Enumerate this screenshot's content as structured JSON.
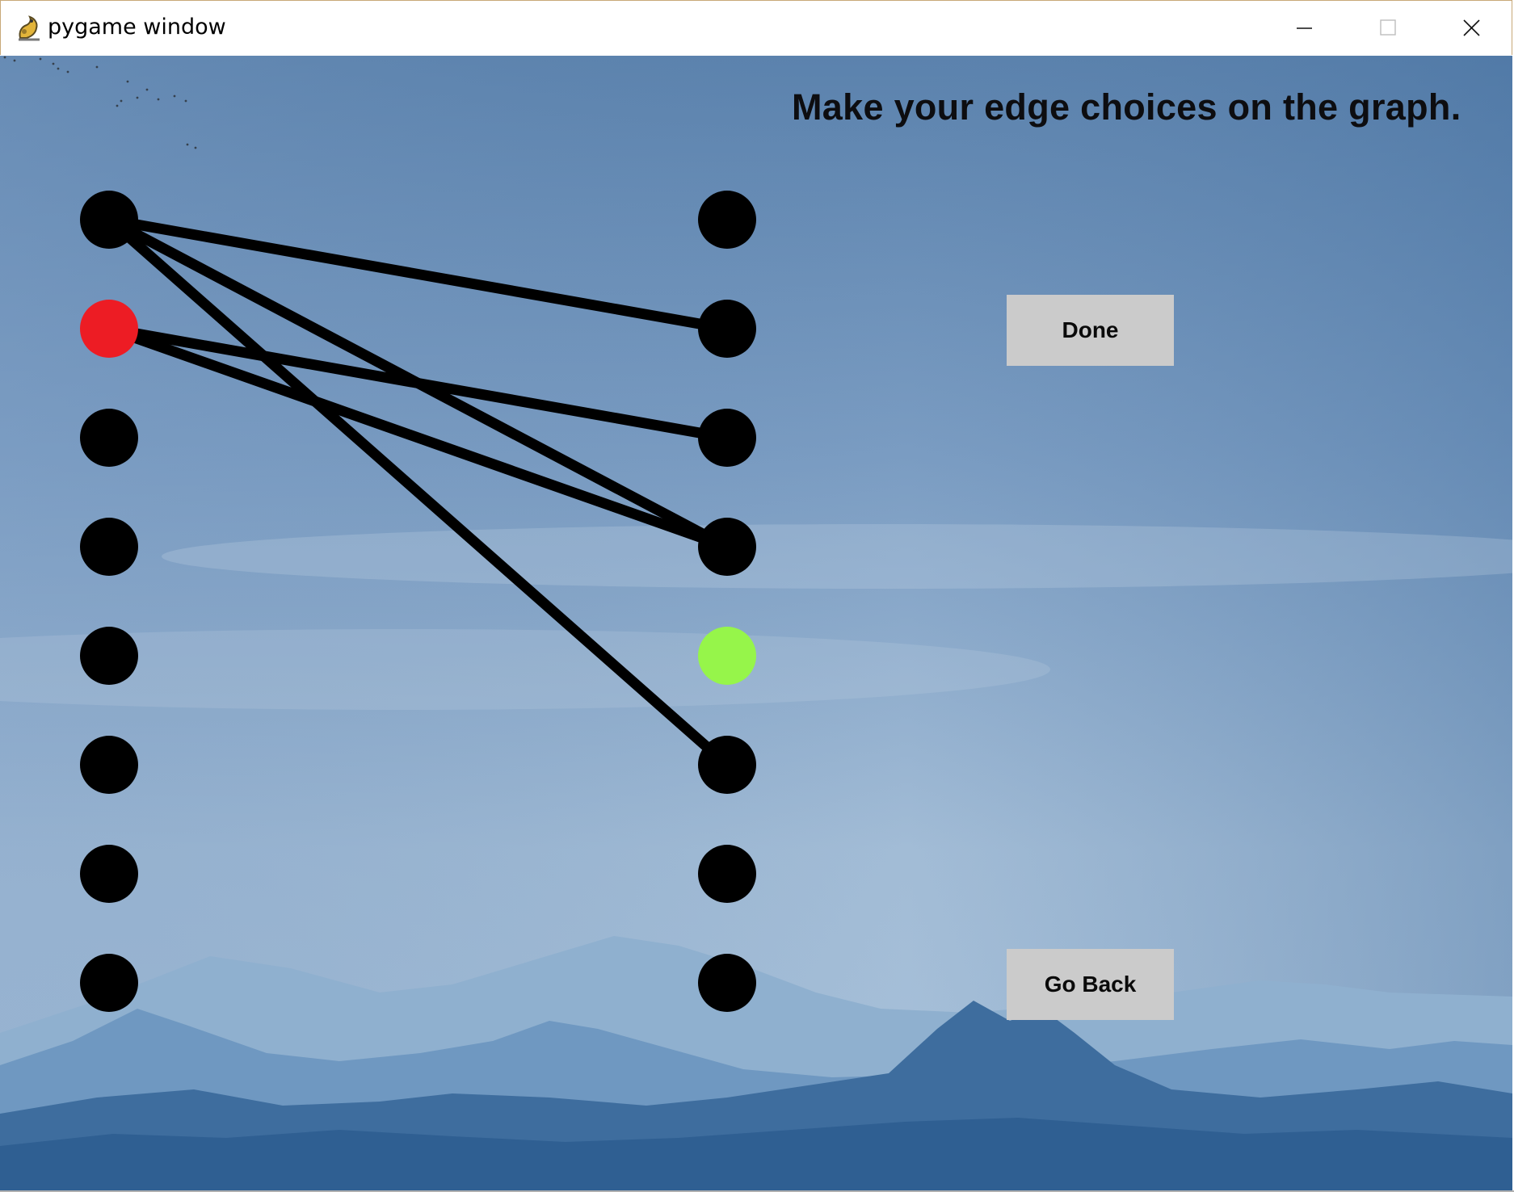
{
  "window": {
    "title": "pygame window",
    "controls": {
      "minimize": "minimize",
      "maximize": "maximize",
      "close": "close"
    }
  },
  "game": {
    "instruction": "Make your edge choices on the graph.",
    "buttons": {
      "done": "Done",
      "go_back": "Go Back"
    },
    "graph": {
      "left_nodes": [
        {
          "id": 0,
          "color": "#000000",
          "state": "normal"
        },
        {
          "id": 1,
          "color": "#ed1c24",
          "state": "selected"
        },
        {
          "id": 2,
          "color": "#000000",
          "state": "normal"
        },
        {
          "id": 3,
          "color": "#000000",
          "state": "normal"
        },
        {
          "id": 4,
          "color": "#000000",
          "state": "normal"
        },
        {
          "id": 5,
          "color": "#000000",
          "state": "normal"
        },
        {
          "id": 6,
          "color": "#000000",
          "state": "normal"
        },
        {
          "id": 7,
          "color": "#000000",
          "state": "normal"
        }
      ],
      "right_nodes": [
        {
          "id": 0,
          "color": "#000000",
          "state": "normal"
        },
        {
          "id": 1,
          "color": "#000000",
          "state": "normal"
        },
        {
          "id": 2,
          "color": "#000000",
          "state": "normal"
        },
        {
          "id": 3,
          "color": "#000000",
          "state": "normal"
        },
        {
          "id": 4,
          "color": "#96f54a",
          "state": "highlighted"
        },
        {
          "id": 5,
          "color": "#000000",
          "state": "normal"
        },
        {
          "id": 6,
          "color": "#000000",
          "state": "normal"
        },
        {
          "id": 7,
          "color": "#000000",
          "state": "normal"
        }
      ],
      "edges": [
        {
          "from_left": 0,
          "to_right": 1
        },
        {
          "from_left": 0,
          "to_right": 3
        },
        {
          "from_left": 0,
          "to_right": 5
        },
        {
          "from_left": 1,
          "to_right": 2
        },
        {
          "from_left": 1,
          "to_right": 3
        }
      ]
    }
  },
  "colors": {
    "sky_top": "#5b82ad",
    "sky_bottom": "#a9c2da",
    "edge": "#000000",
    "button_bg": "#cbcbcb"
  }
}
